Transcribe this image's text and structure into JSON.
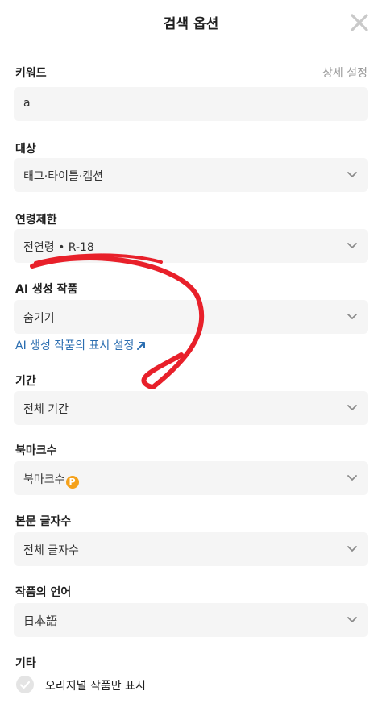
{
  "header": {
    "title": "검색 옵션"
  },
  "keyword": {
    "label": "키워드",
    "detail_link": "상세 설정",
    "value": "a"
  },
  "target": {
    "label": "대상",
    "value": "태그·타이틀·캡션"
  },
  "age_limit": {
    "label": "연령제한",
    "value": "전연령 • R-18"
  },
  "ai_works": {
    "label": "AI 생성 작품",
    "value": "숨기기",
    "settings_link": "AI 생성 작품의 표시 설정"
  },
  "period": {
    "label": "기간",
    "value": "전체 기간"
  },
  "bookmarks": {
    "label": "북마크수",
    "value": "북마크수",
    "badge": "P"
  },
  "char_count": {
    "label": "본문 글자수",
    "value": "전체 글자수"
  },
  "language": {
    "label": "작품의 언어",
    "value": "日本語"
  },
  "other": {
    "label": "기타",
    "original_only_label": "오리지널 작품만 표시",
    "original_only_checked": false
  },
  "colors": {
    "link_blue": "#2a6db0",
    "field_bg": "#f5f5f5",
    "premium_orange": "#f5a11a",
    "annotation_red": "#e8202a"
  }
}
